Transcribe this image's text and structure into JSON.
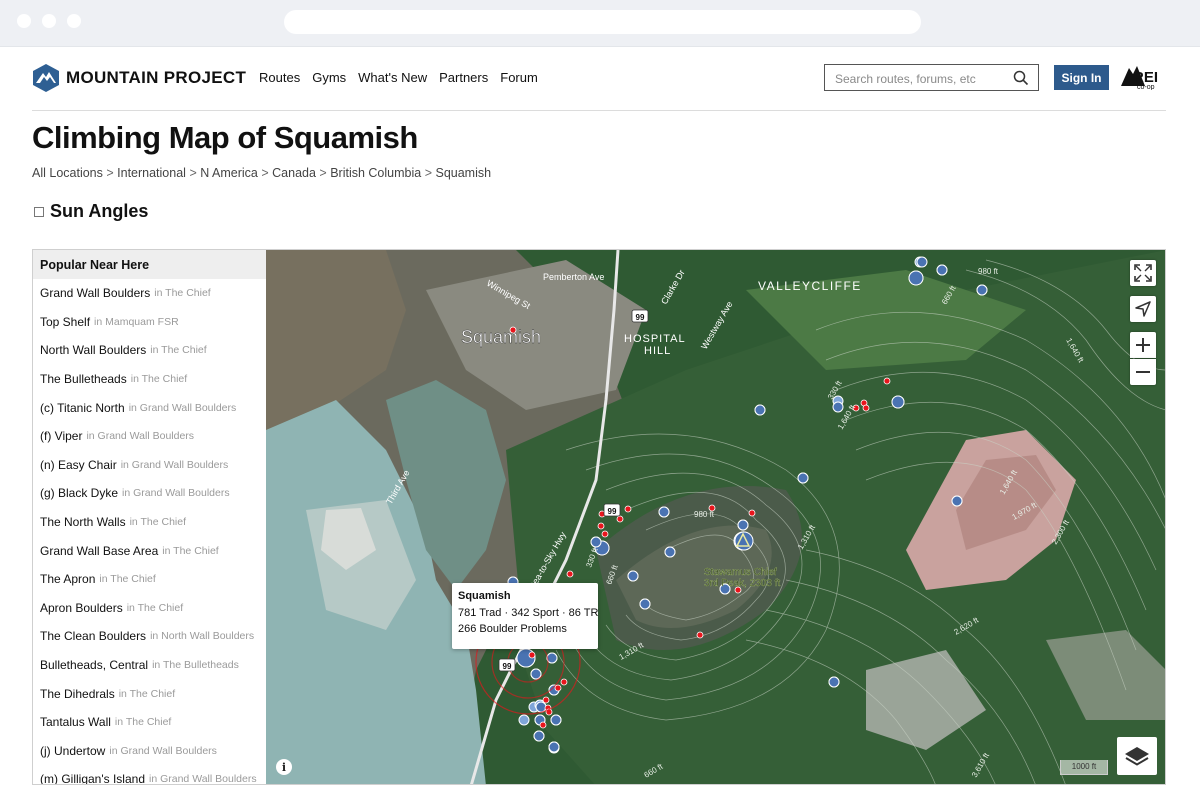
{
  "header": {
    "logo_text": "MOUNTAIN PROJECT",
    "nav": [
      "Routes",
      "Gyms",
      "What's New",
      "Partners",
      "Forum"
    ],
    "search_placeholder": "Search routes, forums, etc",
    "signin_label": "Sign In",
    "partner_logo_text": "REI co-op",
    "colors": {
      "signin_bg": "#2d5a8c"
    }
  },
  "page": {
    "title": "Climbing Map of Squamish",
    "breadcrumbs": [
      "All Locations",
      "International",
      "N America",
      "Canada",
      "British Columbia",
      "Squamish"
    ],
    "sun_angles_label": "Sun Angles",
    "sun_angles_checked": false
  },
  "sidebar": {
    "heading": "Popular Near Here",
    "items": [
      {
        "name": "Grand Wall Boulders",
        "area": "in The Chief"
      },
      {
        "name": "Top Shelf",
        "area": "in Mamquam FSR"
      },
      {
        "name": "North Wall Boulders",
        "area": "in The Chief"
      },
      {
        "name": "The Bulletheads",
        "area": "in The Chief"
      },
      {
        "name": "(c) Titanic North",
        "area": "in Grand Wall Boulders"
      },
      {
        "name": "(f) Viper",
        "area": "in Grand Wall Boulders"
      },
      {
        "name": "(n) Easy Chair",
        "area": "in Grand Wall Boulders"
      },
      {
        "name": "(g) Black Dyke",
        "area": "in Grand Wall Boulders"
      },
      {
        "name": "The North Walls",
        "area": "in The Chief"
      },
      {
        "name": "Grand Wall Base Area",
        "area": "in The Chief"
      },
      {
        "name": "The Apron",
        "area": "in The Chief"
      },
      {
        "name": "Apron Boulders",
        "area": "in The Chief"
      },
      {
        "name": "The Clean Boulders",
        "area": "in North Wall Boulders"
      },
      {
        "name": "Bulletheads, Central",
        "area": "in The Bulletheads"
      },
      {
        "name": "The Dihedrals",
        "area": "in The Chief"
      },
      {
        "name": "Tantalus Wall",
        "area": "in The Chief"
      },
      {
        "name": "(j) Undertow",
        "area": "in Grand Wall Boulders"
      },
      {
        "name": "(m) Gilligan's Island",
        "area": "in Grand Wall Boulders"
      }
    ]
  },
  "map": {
    "labels": {
      "town": "Squamish",
      "hospital_hill_1": "HOSPITAL",
      "hospital_hill_2": "HILL",
      "valleycliffe": "VALLEYCLIFFE",
      "pemberton": "Pemberton Ave",
      "winnipeg": "Winnipeg St",
      "clarke": "Clarke Dr",
      "westway": "Westway Ave",
      "third": "Third Ave",
      "seatosky": "Sea-to-Sky Hwy",
      "highway_shield": "99",
      "peak_1": "Stawamus Chief",
      "peak_2": "3rd Peak, 2303 ft",
      "contour_labels": [
        "980 ft",
        "660 ft",
        "330 ft",
        "1,640 ft",
        "1,310 ft",
        "1,970 ft",
        "2,300 ft",
        "2,620 ft",
        "330 ft",
        "660 ft",
        "980 ft",
        "1,310 ft",
        "3,610 ft",
        "1,640 ft",
        "1,640 ft",
        "660 ft"
      ]
    },
    "popup": {
      "title": "Squamish",
      "line1": "781 Trad · 342 Sport · 86 TR",
      "line2": "266 Boulder Problems"
    },
    "scale_label": "1000 ft",
    "controls": [
      "fullscreen-icon",
      "locate-icon",
      "zoom-in-icon",
      "zoom-out-icon",
      "layers-icon",
      "info-icon"
    ],
    "colors": {
      "route_marker": "#4d74b0",
      "popular_marker": "#e8151c"
    }
  }
}
